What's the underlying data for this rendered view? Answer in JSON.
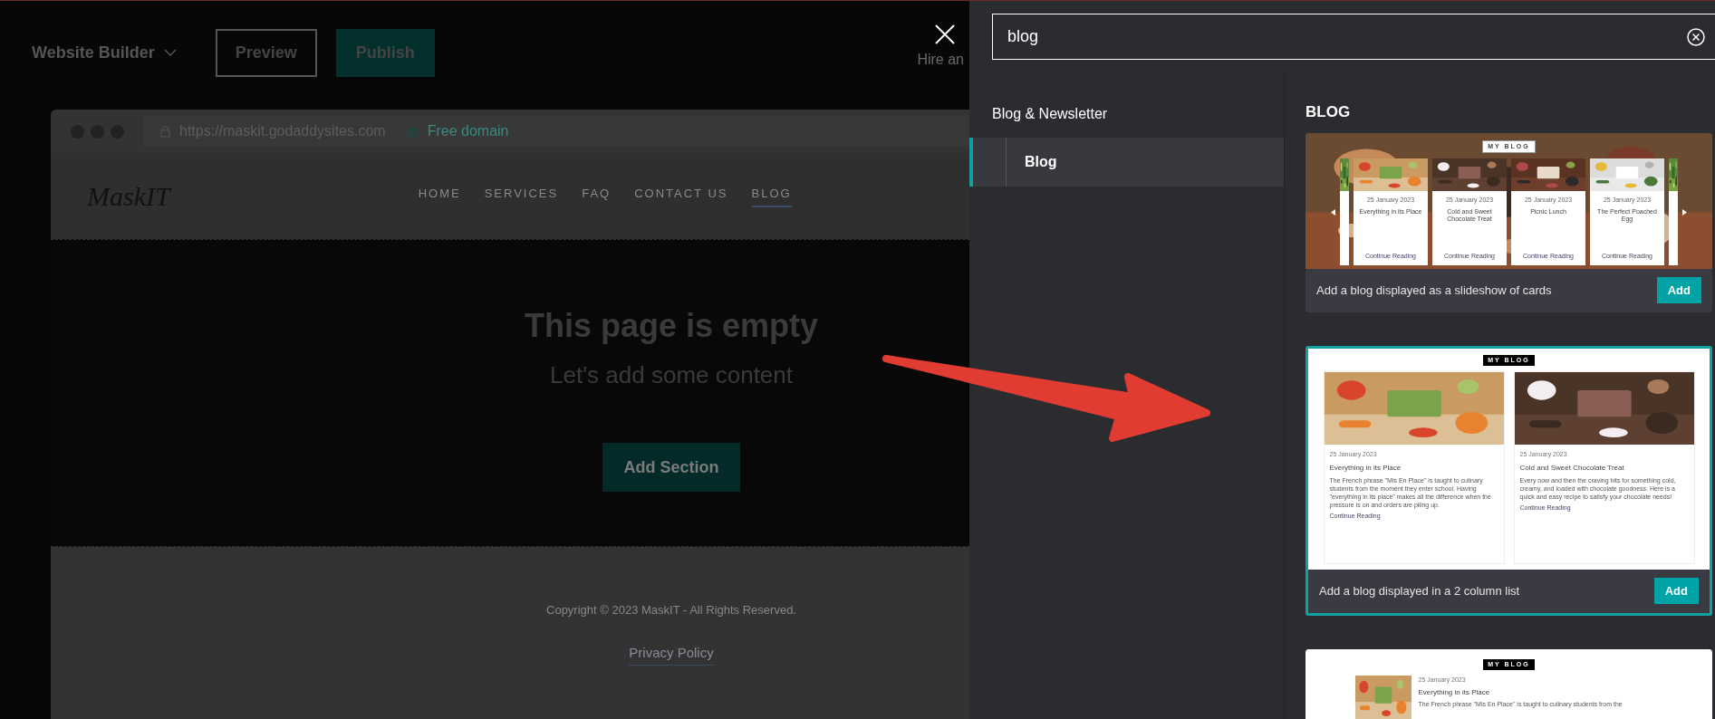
{
  "builder": {
    "title": "Website Builder",
    "buttons": [
      {
        "label": "Preview",
        "kind": "outline"
      },
      {
        "label": "Publish",
        "kind": "filled"
      }
    ],
    "hire_text": "Hire an"
  },
  "browser": {
    "url": "https://maskit.godaddysites.com",
    "domain_link": "Free domain"
  },
  "site": {
    "logo": "MaskIT",
    "nav": [
      {
        "label": "HOME",
        "selected": false
      },
      {
        "label": "SERVICES",
        "selected": false
      },
      {
        "label": "FAQ",
        "selected": false
      },
      {
        "label": "CONTACT US",
        "selected": false
      },
      {
        "label": "BLOG",
        "selected": true
      }
    ],
    "empty_title": "This page is empty",
    "empty_subtitle": "Let's add some content",
    "add_section": "Add Section",
    "copyright": "Copyright © 2023 MaskIT - All Rights Reserved.",
    "privacy": "Privacy Policy"
  },
  "panel": {
    "search": {
      "value": "blog"
    },
    "categories": [
      {
        "label": "Blog & Newsletter",
        "children": [
          {
            "label": "Blog",
            "selected": true
          }
        ]
      }
    ],
    "section_title": "BLOG",
    "templates": [
      {
        "kind": "slideshow",
        "selected": false,
        "badge": "MY BLOG",
        "caption": "Add a blog displayed as a slideshow of cards",
        "add": "Add",
        "posts": [
          {
            "date": "25 January 2023",
            "title": "Everything in its Place",
            "link": "Continue Reading"
          },
          {
            "date": "25 January 2023",
            "title": "Cold and Sweet Chocolate Treat",
            "link": "Continue Reading"
          },
          {
            "date": "25 January 2023",
            "title": "Picnic Lunch",
            "link": "Continue Reading"
          },
          {
            "date": "25 January 2023",
            "title": "The Perfect Poached Egg",
            "link": "Continue Reading"
          }
        ]
      },
      {
        "kind": "two_column",
        "selected": true,
        "badge": "MY BLOG",
        "caption": "Add a blog displayed in a 2 column list",
        "add": "Add",
        "posts": [
          {
            "date": "25 January 2023",
            "title": "Everything in its Place",
            "excerpt": "The French phrase \"Mis En Place\" is taught to culinary students from the moment they enter school. Having \"everything in its place\" makes all the difference when the pressure is on and orders are piling up.",
            "link": "Continue Reading"
          },
          {
            "date": "25 January 2023",
            "title": "Cold and Sweet Chocolate Treat",
            "excerpt": "Every now and then the craving hits for something cold, creamy, and loaded with chocolate goodness. Here is a quick and easy recipe to satisfy your chocolate needs!",
            "link": "Continue Reading"
          }
        ]
      },
      {
        "kind": "list",
        "selected": false,
        "badge": "MY BLOG",
        "posts": [
          {
            "date": "25 January 2023",
            "title": "Everything in its Place",
            "excerpt": "The French phrase \"Mis En Place\" is taught to culinary students from the"
          }
        ]
      }
    ]
  }
}
